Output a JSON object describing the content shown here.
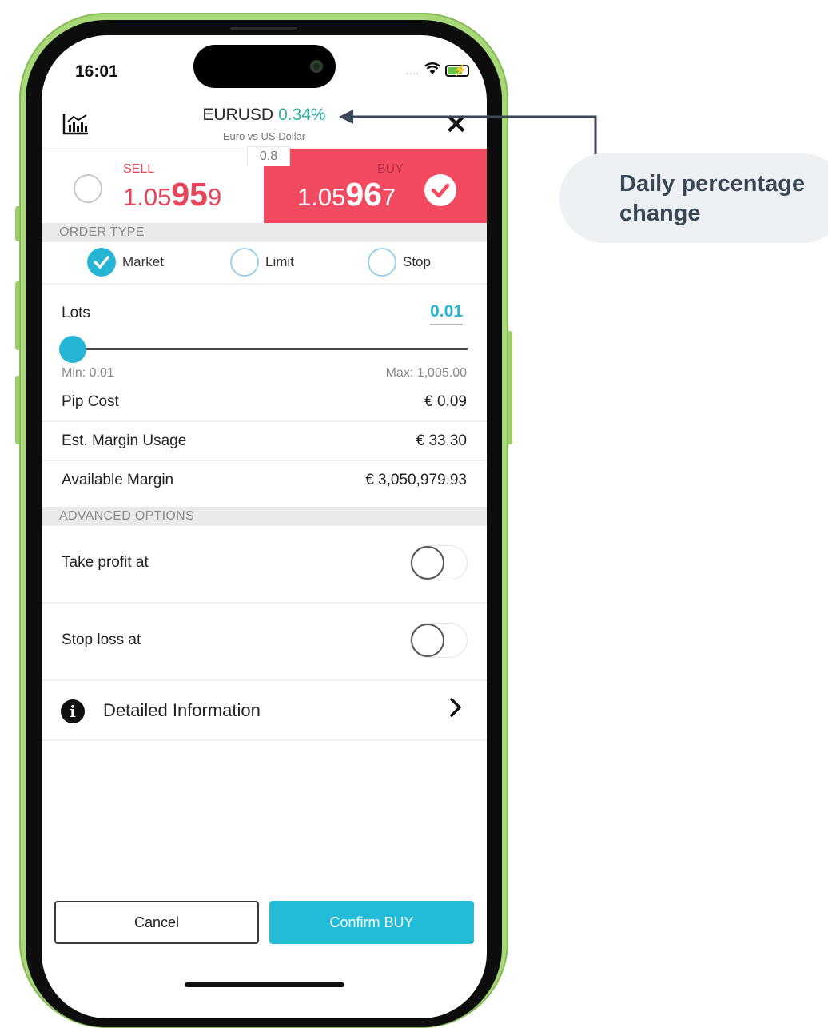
{
  "status_bar": {
    "time": "16:01",
    "signal": "....",
    "wifi_icon": "wifi-icon",
    "battery_icon": "battery-charging-icon"
  },
  "header": {
    "symbol": "EURUSD",
    "change_pct": "0.34%",
    "subtitle": "Euro vs US Dollar",
    "chart_icon": "chart-icon",
    "close_icon": "close-icon",
    "close_glyph": "✕"
  },
  "prices": {
    "spread": "0.8",
    "sell": {
      "label": "SELL",
      "prefix": "1.05",
      "big": "95",
      "suffix": "9"
    },
    "buy": {
      "label": "BUY",
      "prefix": "1.05",
      "big": "96",
      "suffix": "7"
    }
  },
  "order_type": {
    "section_title": "ORDER TYPE",
    "options": [
      {
        "label": "Market",
        "selected": true
      },
      {
        "label": "Limit",
        "selected": false
      },
      {
        "label": "Stop",
        "selected": false
      }
    ]
  },
  "lots": {
    "label": "Lots",
    "value": "0.01",
    "min_label": "Min: 0.01",
    "max_label": "Max: 1,005.00",
    "slider_fraction": 0.0
  },
  "details": {
    "pip_cost": {
      "label": "Pip Cost",
      "value": "€ 0.09"
    },
    "margin_usage": {
      "label": "Est. Margin Usage",
      "value": "€ 33.30"
    },
    "available_margin": {
      "label": "Available Margin",
      "value": "€ 3,050,979.93"
    }
  },
  "advanced": {
    "section_title": "ADVANCED OPTIONS",
    "take_profit": {
      "label": "Take profit at",
      "enabled": false
    },
    "stop_loss": {
      "label": "Stop loss at",
      "enabled": false
    }
  },
  "detailed_info": {
    "label": "Detailed Information",
    "icon": "info-icon",
    "chevron": "›"
  },
  "actions": {
    "cancel": "Cancel",
    "confirm": "Confirm BUY"
  },
  "callout": {
    "text": "Daily percentage change"
  },
  "colors": {
    "sell_red": "#e8445a",
    "buy_bg": "#f24a60",
    "accent_teal": "#27b5d6",
    "change_green": "#2ab3a4",
    "phone_frame": "#a8d878"
  }
}
